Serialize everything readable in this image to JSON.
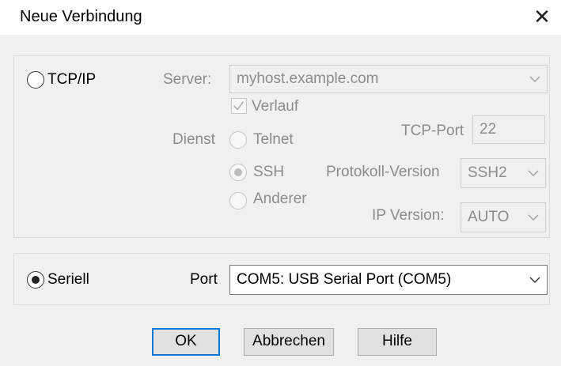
{
  "window": {
    "title": "Neue Verbindung",
    "close_glyph": "✕",
    "close_icon": "close-icon"
  },
  "tcpip": {
    "label": "TCP/IP",
    "selected": false,
    "enabled": true,
    "server_label": "Server:",
    "server_value": "myhost.example.com",
    "history_label": "Verlauf",
    "history_checked": true,
    "service_label": "Dienst",
    "services": [
      {
        "label": "Telnet",
        "selected": false
      },
      {
        "label": "SSH",
        "selected": true
      },
      {
        "label": "Anderer",
        "selected": false
      }
    ],
    "tcp_port_label": "TCP-Port",
    "tcp_port_value": "22",
    "protocol_version_label": "Protokoll-Version",
    "protocol_version_value": "SSH2",
    "ip_version_label": "IP Version:",
    "ip_version_value": "AUTO"
  },
  "serial": {
    "label": "Seriell",
    "selected": true,
    "port_label": "Port",
    "port_value": "COM5: USB Serial Port (COM5)"
  },
  "buttons": {
    "ok": "OK",
    "cancel": "Abbrechen",
    "help": "Hilfe"
  },
  "colors": {
    "dialog_background": "#f0f0f0",
    "default_button_border": "#0078d7",
    "disabled_text": "#8c8c8c"
  }
}
